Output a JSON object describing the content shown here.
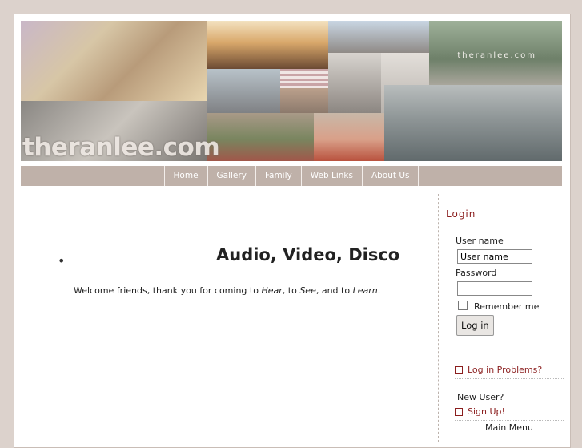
{
  "header": {
    "site_tag": "theranlee.com",
    "logo_text": "theranlee.com"
  },
  "nav": {
    "items": [
      {
        "label": "Home"
      },
      {
        "label": "Gallery"
      },
      {
        "label": "Family"
      },
      {
        "label": "Web Links"
      },
      {
        "label": "About Us"
      }
    ]
  },
  "main": {
    "bullet": "•",
    "title": "Audio, Video, Disco",
    "welcome_prefix": "Welcome friends, thank you for coming to ",
    "welcome_hear": "Hear",
    "welcome_sep1": ", to ",
    "welcome_see": "See",
    "welcome_sep2": ", and to ",
    "welcome_learn": "Learn",
    "welcome_end": "."
  },
  "login": {
    "title": "Login",
    "username_label": "User name",
    "username_value": "User name",
    "password_label": "Password",
    "password_value": "",
    "remember_label": "Remember me",
    "button_label": "Log in",
    "problems_link": "Log in Problems?",
    "new_user_label": "New User?",
    "signup_link": "Sign Up!",
    "main_menu_label": "Main Menu"
  },
  "colors": {
    "accent": "#8b1e1e",
    "nav_bg": "#bfb1a9",
    "page_bg": "#dcd2cc"
  }
}
